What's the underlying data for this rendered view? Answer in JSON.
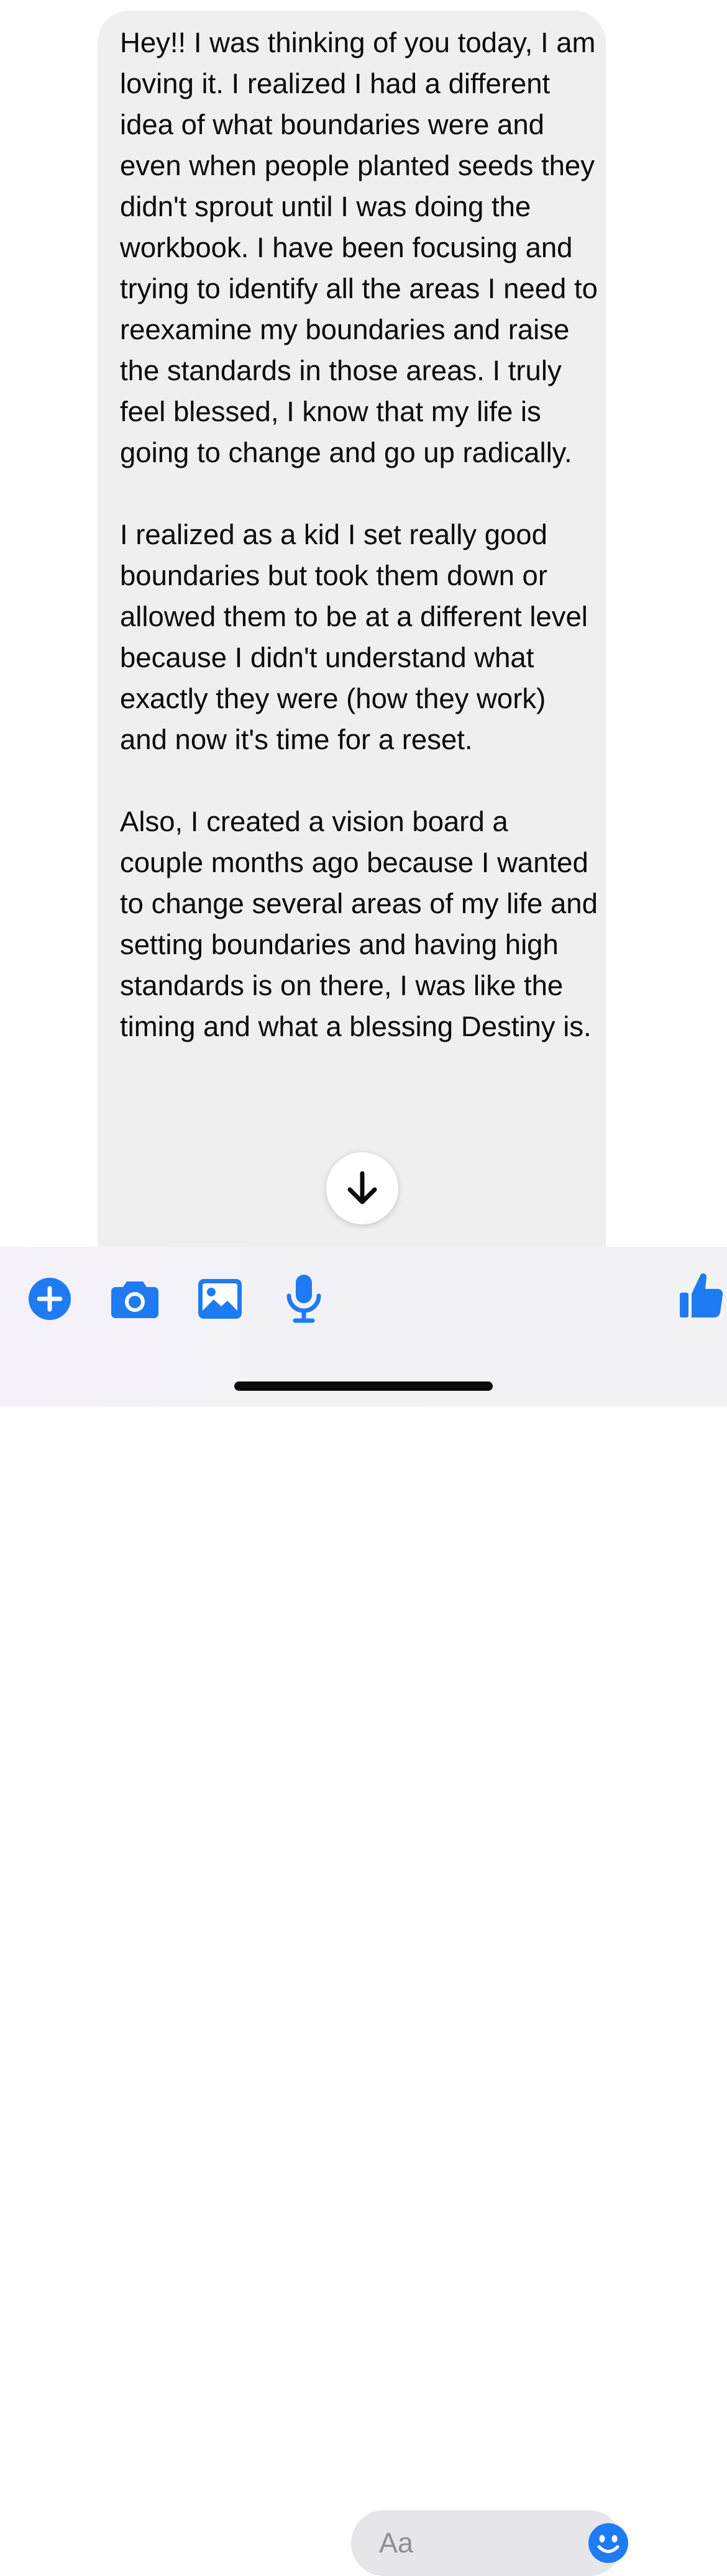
{
  "message": {
    "paragraphs": [
      "Hey!! I was thinking of you today, I am loving it. I realized I had a different idea of what boundaries were and even when people planted seeds they didn't sprout until I was doing the workbook. I have been focusing and trying to identify all the areas I need to reexamine my boundaries and raise the standards in those areas. I truly feel blessed, I know that my life is going to change and go up radically.",
      "I realized as a kid I set really good boundaries but took them down or allowed them to be at a different level because I didn't understand what exactly they were (how they work) and now it's time for a reset.",
      "Also, I created a vision board a couple months ago because I wanted to change several areas of my life and setting boundaries and having high standards is on there, I was like the timing and what a blessing Destiny is."
    ]
  },
  "composer": {
    "placeholder": "Aa",
    "accent_color": "#1f7bf2",
    "icons": [
      "plus-icon",
      "camera-icon",
      "photo-icon",
      "microphone-icon",
      "emoji-icon",
      "thumbs-up-icon"
    ]
  },
  "scroll_button": {
    "icon": "arrow-down-icon"
  }
}
